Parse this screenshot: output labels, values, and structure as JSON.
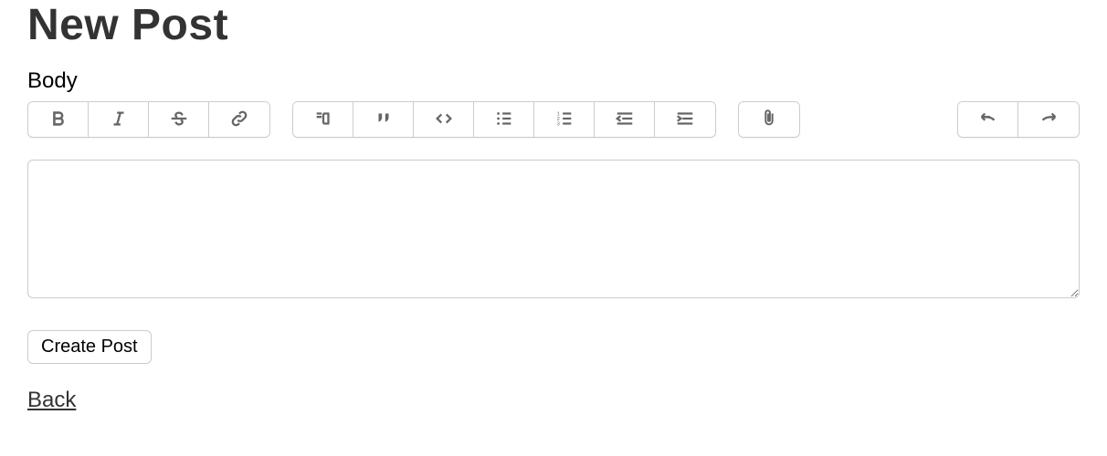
{
  "page": {
    "title": "New Post"
  },
  "form": {
    "body_label": "Body",
    "body_value": "",
    "submit_label": "Create Post"
  },
  "nav": {
    "back_label": "Back"
  },
  "toolbar": {
    "bold": "Bold",
    "italic": "Italic",
    "strike": "Strikethrough",
    "link": "Link",
    "heading": "Heading",
    "quote": "Quote",
    "code": "Code",
    "bullet_list": "Bullet List",
    "number_list": "Numbered List",
    "outdent": "Decrease Indent",
    "indent": "Increase Indent",
    "attach": "Attach File",
    "undo": "Undo",
    "redo": "Redo"
  }
}
